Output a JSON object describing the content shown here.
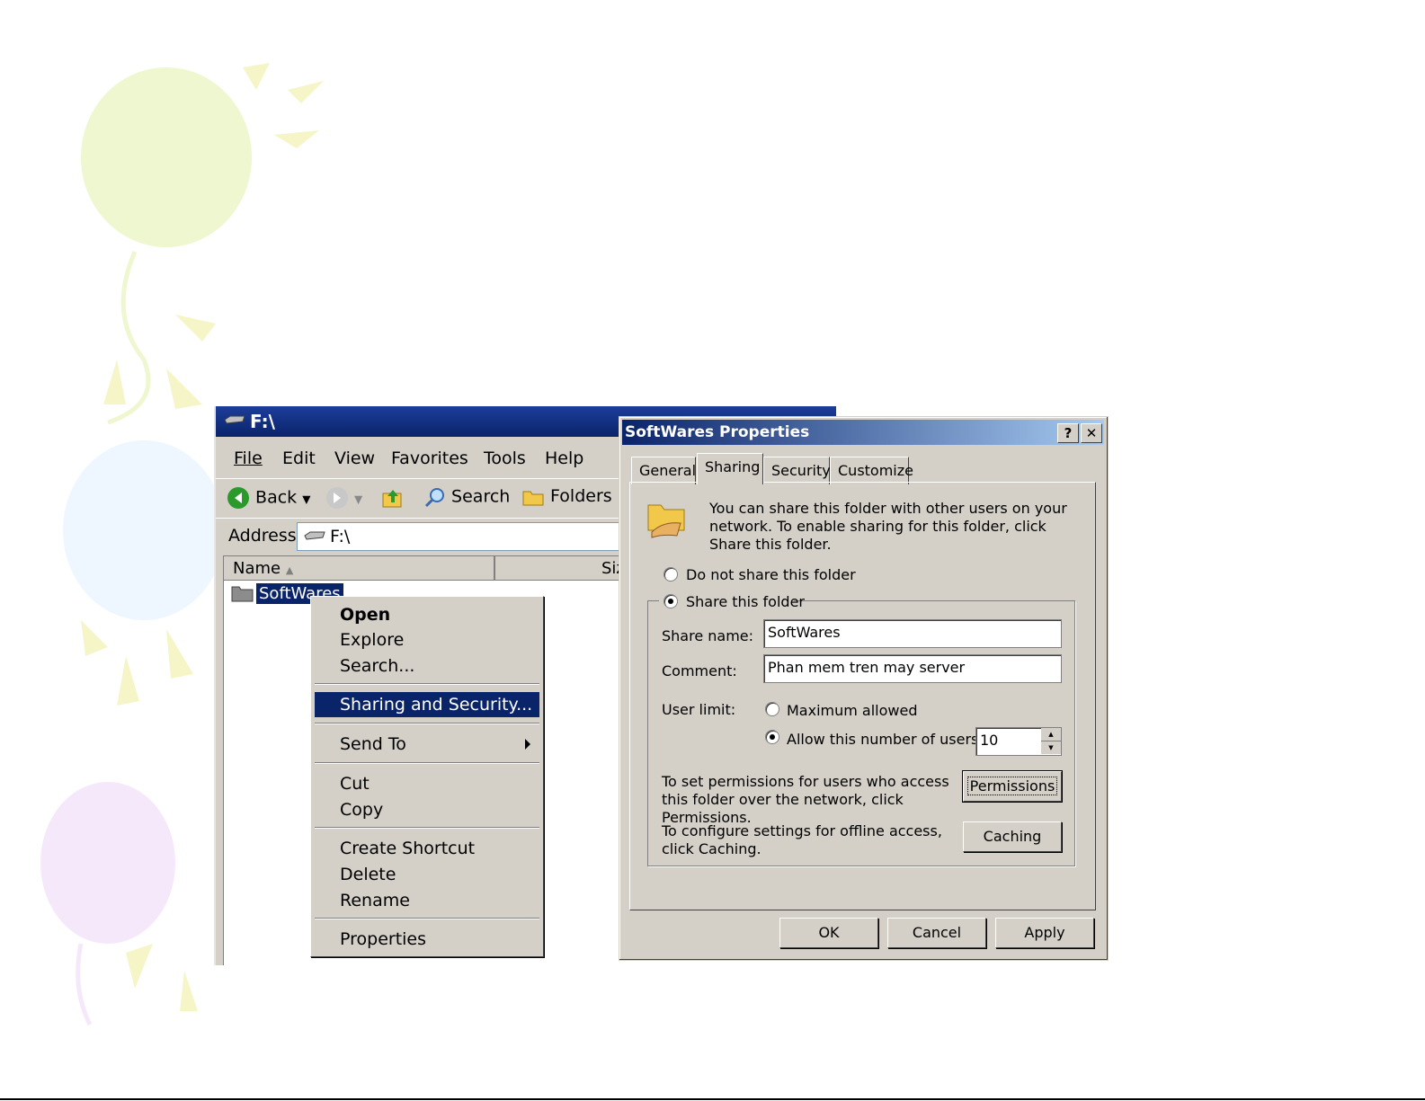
{
  "explorer": {
    "title": "F:\\",
    "menu": [
      "File",
      "Edit",
      "View",
      "Favorites",
      "Tools",
      "Help"
    ],
    "toolbar": {
      "back": "Back",
      "search": "Search",
      "folders": "Folders"
    },
    "address": {
      "label": "Address",
      "value": "F:\\"
    },
    "columns": {
      "name": "Name",
      "size": "Siz"
    },
    "file": "SoftWares"
  },
  "context_menu": {
    "items": [
      "Open",
      "Explore",
      "Search...",
      "Sharing and Security...",
      "Send To",
      "Cut",
      "Copy",
      "Create Shortcut",
      "Delete",
      "Rename",
      "Properties"
    ],
    "highlighted": "Sharing and Security..."
  },
  "dialog": {
    "title": "SoftWares Properties",
    "help_btn": "?",
    "close_btn": "✕",
    "tabs": [
      "General",
      "Sharing",
      "Security",
      "Customize"
    ],
    "active_tab": "Sharing",
    "description": "You can share this folder with other users on your network.  To enable sharing for this folder, click Share this folder.",
    "do_not_share": "Do not share this folder",
    "share_this": "Share this folder",
    "share_name_label": "Share name:",
    "share_name_value": "SoftWares",
    "comment_label": "Comment:",
    "comment_value": "Phan mem tren may server",
    "user_limit_label": "User limit:",
    "max_allowed": "Maximum allowed",
    "allow_number": "Allow this number of users:",
    "user_count": "10",
    "permissions_text": "To set permissions for users who access this folder over the network, click Permissions.",
    "permissions_btn": "Permissions",
    "caching_text": "To configure settings for offline access, click Caching.",
    "caching_btn": "Caching",
    "ok": "OK",
    "cancel": "Cancel",
    "apply": "Apply"
  }
}
